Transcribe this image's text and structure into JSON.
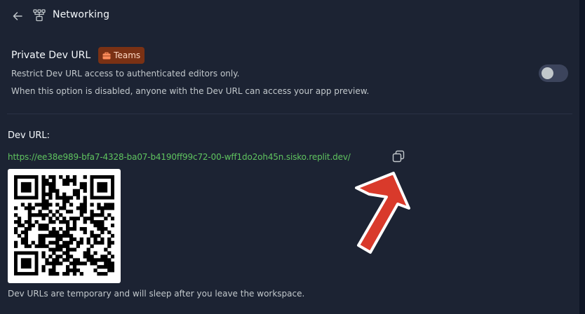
{
  "header": {
    "title": "Networking",
    "back_icon": "arrow-left-icon",
    "section_icon": "network-icon"
  },
  "private_dev_url": {
    "title": "Private Dev URL",
    "badge": "Teams",
    "badge_icon": "briefcase-icon",
    "description": "Restrict Dev URL access to authenticated editors only.",
    "note": "When this option is disabled, anyone with the Dev URL can access your app preview.",
    "enabled": false
  },
  "dev_url": {
    "label": "Dev URL:",
    "url": "https://ee38e989-bfa7-4328-ba07-b4190ff99c72-00-wff1do2oh45n.sisko.replit.dev/",
    "copy_icon": "copy-icon",
    "qr_icon": "qr-code",
    "footnote": "Dev URLs are temporary and will sleep after you leave the workspace."
  },
  "annotation": {
    "icon": "red-arrow-icon",
    "color": "#d93a2b"
  },
  "colors": {
    "background": "#1c2333",
    "link": "#5fc35f",
    "badge_bg": "#7a3114",
    "badge_text": "#ffd9c4"
  }
}
